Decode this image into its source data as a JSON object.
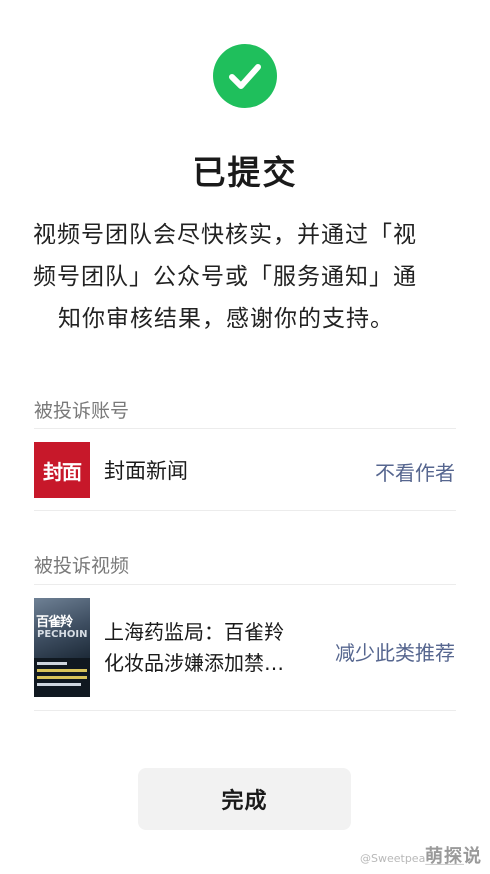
{
  "header": {
    "icon": "check-circle-icon",
    "icon_color": "#1fbf5c",
    "title": "已提交"
  },
  "message": {
    "lines": [
      "视频号团队会尽快核实，并通过「视",
      "频号团队」公众号或「服务通知」通",
      "知你审核结果，感谢你的支持。"
    ]
  },
  "reported_account": {
    "section_label": "被投诉账号",
    "logo_text": "封面",
    "logo_color": "#c7182a",
    "name": "封面新闻",
    "action": "不看作者"
  },
  "reported_video": {
    "section_label": "被投诉视频",
    "thumbnail_headline": "百雀羚",
    "thumbnail_sub": "PECHOIN",
    "title_lines": [
      "上海药监局：百雀羚",
      "化妆品涉嫌添加禁…"
    ],
    "action": "减少此类推荐"
  },
  "footer": {
    "done_label": "完成",
    "watermark_small": "@Sweetpea_______",
    "watermark_brand": "萌探说"
  },
  "colors": {
    "link": "#56668f",
    "section_label": "#7a7a7a",
    "button_bg": "#f2f2f2"
  }
}
